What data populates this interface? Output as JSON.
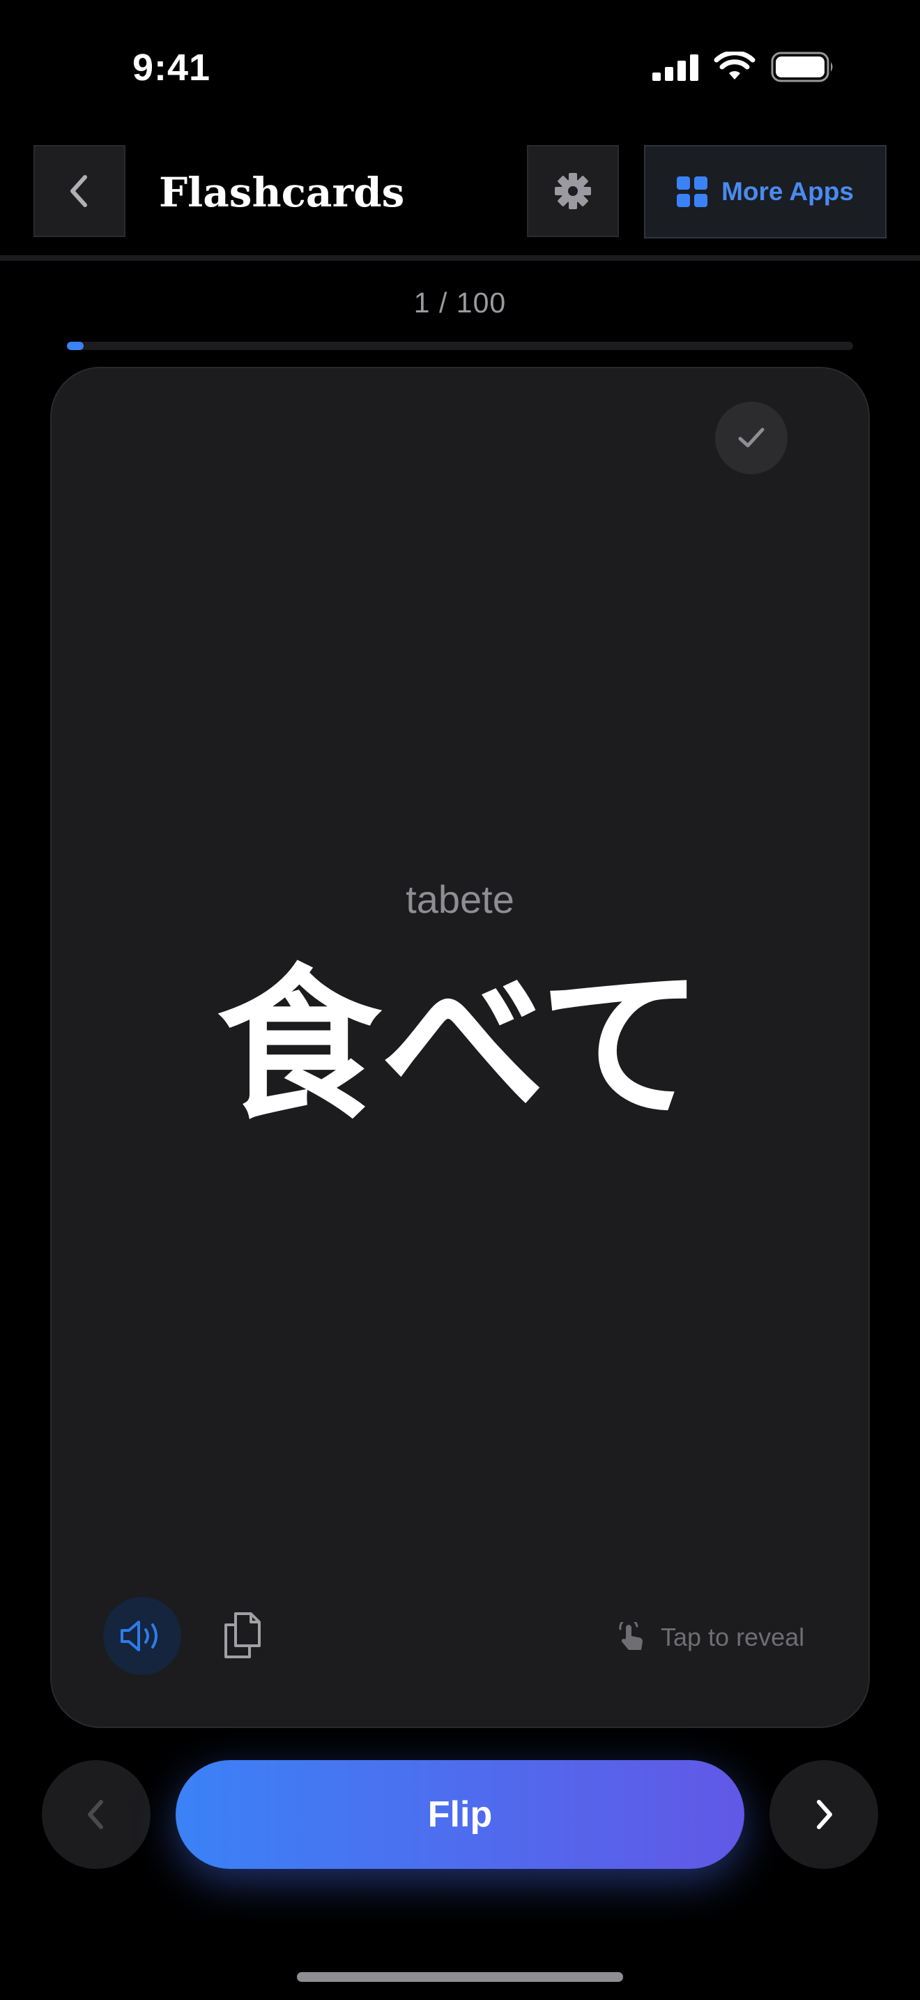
{
  "status_bar": {
    "time": "9:41",
    "icons": [
      "cellular-signal-icon",
      "wifi-icon",
      "battery-icon"
    ]
  },
  "header": {
    "title": "Flashcards",
    "back_icon": "chevron-left-icon",
    "settings_icon": "gear-icon",
    "more_apps_icon": "grid-icon",
    "more_apps_label": "More Apps"
  },
  "progress": {
    "text": "1 / 100",
    "current": 1,
    "total": 100,
    "fraction": 0.01
  },
  "card": {
    "romaji": "tabete",
    "word": "食べて",
    "mastered_icon": "checkmark-icon",
    "speaker_icon": "speaker-icon",
    "copy_icon": "copy-icon",
    "hint_icon": "tap-hand-icon",
    "hint_label": "Tap to reveal"
  },
  "controls": {
    "prev_icon": "chevron-left-icon",
    "flip_label": "Flip",
    "next_icon": "chevron-right-icon"
  },
  "colors": {
    "background": "#000000",
    "card": "#1c1c1e",
    "accent": "#3b82f6",
    "accent_gradient_end": "#6158e6",
    "muted_text": "#8e8e93"
  }
}
